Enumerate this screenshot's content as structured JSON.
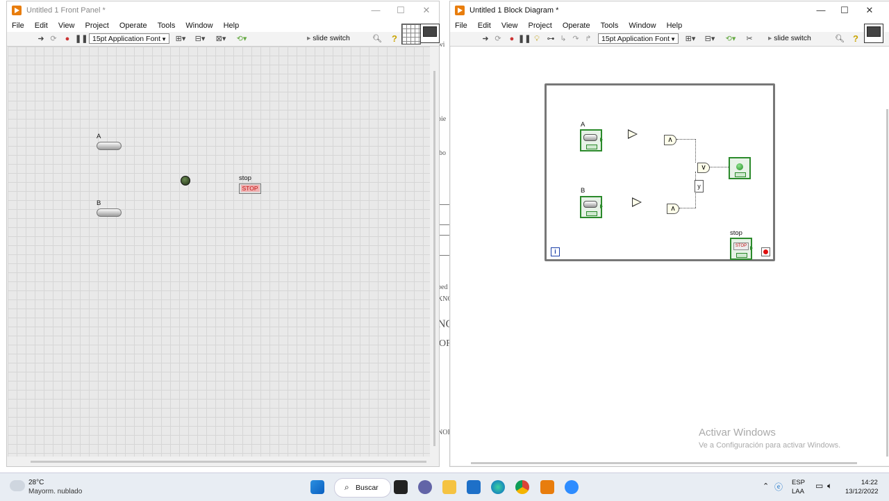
{
  "background_document": {
    "fragments": [
      "cwi",
      "pie",
      "bo",
      "ped",
      "XNO",
      "NC",
      "OR",
      "NOR"
    ]
  },
  "front_panel": {
    "title": "Untitled 1 Front Panel *",
    "menu": [
      "File",
      "Edit",
      "View",
      "Project",
      "Operate",
      "Tools",
      "Window",
      "Help"
    ],
    "font_selector": "15pt Application Font",
    "search_text": "slide switch",
    "controls": {
      "switch_a_label": "A",
      "switch_b_label": "B",
      "stop_label": "stop",
      "stop_button_text": "STOP"
    }
  },
  "block_diagram": {
    "title": "Untitled 1 Block Diagram *",
    "menu": [
      "File",
      "Edit",
      "View",
      "Project",
      "Operate",
      "Tools",
      "Window",
      "Help"
    ],
    "font_selector": "15pt Application Font",
    "search_text": "slide switch",
    "nodes": {
      "terminal_a_label": "A",
      "terminal_b_label": "B",
      "stop_label": "stop",
      "stop_terminal_text": "STOP",
      "and_gate_symbol": "Λ",
      "or_gate_symbol": "V",
      "output_label": "y",
      "iteration_symbol": "i"
    }
  },
  "watermark": {
    "title": "Activar Windows",
    "subtitle": "Ve a Configuración para activar Windows."
  },
  "taskbar": {
    "weather_temp": "28°C",
    "weather_desc": "Mayorm. nublado",
    "search_label": "Buscar",
    "language": "ESP",
    "layout": "LAA",
    "time": "14:22",
    "date": "13/12/2022"
  }
}
